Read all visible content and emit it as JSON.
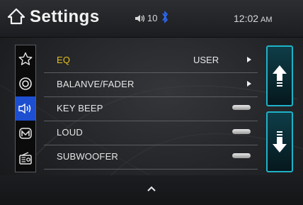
{
  "header": {
    "title": "Settings",
    "volume": "10",
    "time": "12:02",
    "ampm": "AM",
    "icons": [
      "home-icon",
      "speaker-volume-icon",
      "bluetooth-icon"
    ]
  },
  "sidebar": {
    "items": [
      {
        "name": "favorites",
        "icon": "star-icon",
        "active": false
      },
      {
        "name": "general",
        "icon": "target-icon",
        "active": false
      },
      {
        "name": "audio",
        "icon": "speaker-sound-icon",
        "active": true
      },
      {
        "name": "mode",
        "icon": "m-icon",
        "active": false
      },
      {
        "name": "radio",
        "icon": "radio-icon",
        "active": false
      }
    ]
  },
  "menu": {
    "items": [
      {
        "label": "EQ",
        "value": "USER",
        "control": "arrow",
        "highlighted": true
      },
      {
        "label": "BALANVE/FADER",
        "value": "",
        "control": "arrow",
        "highlighted": false
      },
      {
        "label": "KEY BEEP",
        "value": "",
        "control": "toggle",
        "highlighted": false
      },
      {
        "label": "LOUD",
        "value": "",
        "control": "toggle",
        "highlighted": false
      },
      {
        "label": "SUBWOOFER",
        "value": "",
        "control": "toggle",
        "highlighted": false
      }
    ]
  },
  "scroll": {
    "up_icon": "arrow-up-icon",
    "down_icon": "arrow-down-icon"
  },
  "footer": {
    "collapse_icon": "chevron-up-icon"
  },
  "colors": {
    "accent": "#1fb2c8",
    "highlight": "#e3c020",
    "active": "#1d4fd0",
    "bluetooth": "#2a6cff"
  }
}
